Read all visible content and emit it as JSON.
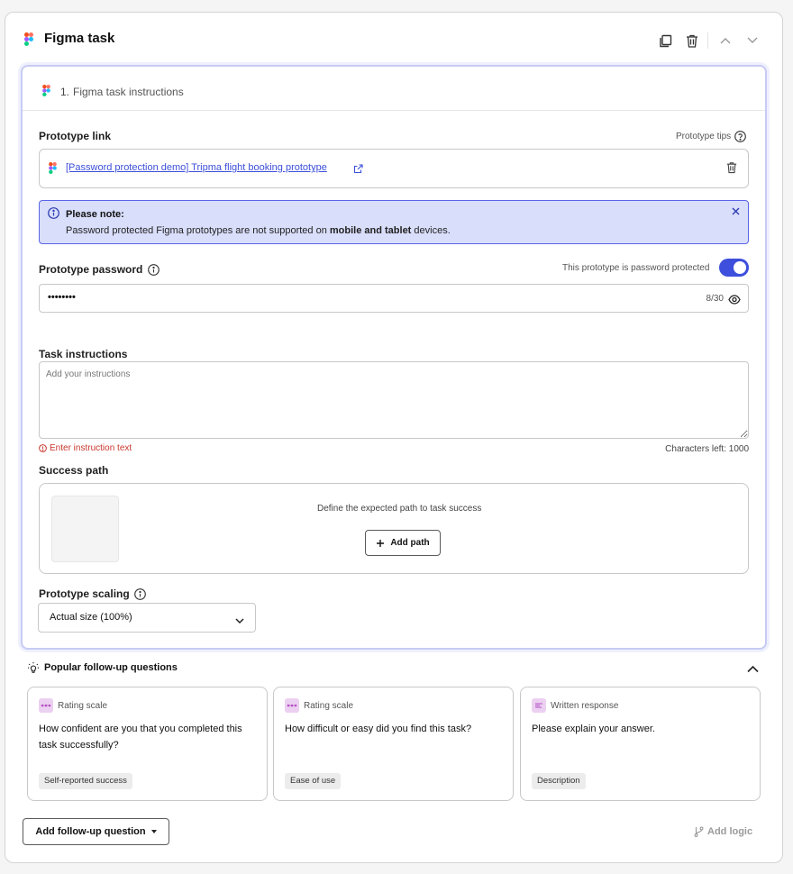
{
  "header": {
    "title": "Figma task",
    "copy_icon": "copy-icon",
    "delete_icon": "trash-icon",
    "up_icon": "chevron-up-icon",
    "down_icon": "chevron-down-icon"
  },
  "panel": {
    "number": "1.",
    "title": "Figma task instructions"
  },
  "prototype_link": {
    "label": "Prototype link",
    "tips": "Prototype tips",
    "link_text": "[Password protection demo] Tripma flight booking prototype"
  },
  "note": {
    "title": "Please note:",
    "text_before": "Password protected Figma prototypes are not supported on ",
    "text_bold": "mobile and tablet",
    "text_after": " devices."
  },
  "password": {
    "label": "Prototype password",
    "toggle_label": "This prototype is password protected",
    "toggle_on": true,
    "value": "••••••••",
    "counter": "8/30"
  },
  "task_instructions": {
    "label": "Task instructions",
    "placeholder": "Add your instructions",
    "error": "Enter instruction text",
    "chars_left": "Characters left: 1000"
  },
  "success_path": {
    "label": "Success path",
    "description": "Define the expected path to task success",
    "add_button": "Add path"
  },
  "scaling": {
    "label": "Prototype scaling",
    "selected": "Actual size (100%)"
  },
  "follow_up": {
    "title": "Popular follow-up questions",
    "cards": [
      {
        "type": "Rating scale",
        "question": "How confident are you that you completed this task successfully?",
        "tag": "Self-reported success"
      },
      {
        "type": "Rating scale",
        "question": "How difficult or easy did you find this task?",
        "tag": "Ease of use"
      },
      {
        "type": "Written response",
        "question": "Please explain your answer.",
        "tag": "Description"
      }
    ]
  },
  "footer": {
    "add_follow_up": "Add follow-up question",
    "add_logic": "Add logic"
  },
  "colors": {
    "accent": "#3d4fdc",
    "note_bg": "#d9defb",
    "error": "#c9362c",
    "panel_border": "#c7cbf3"
  }
}
